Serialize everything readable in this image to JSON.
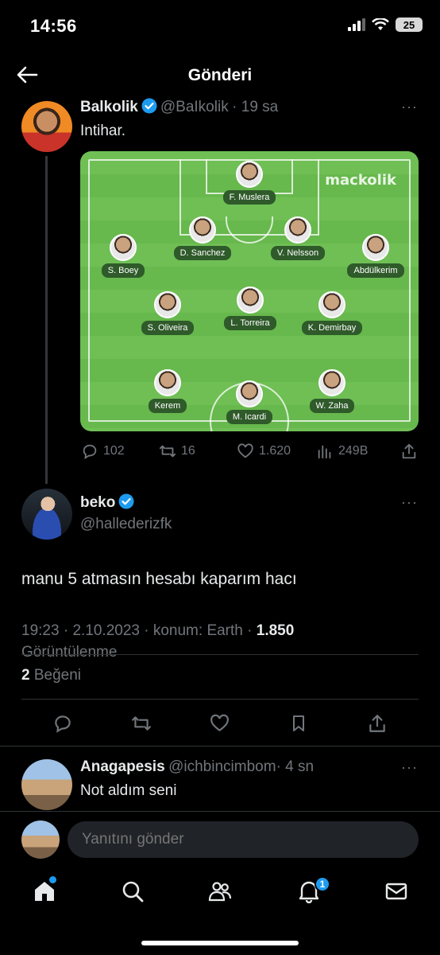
{
  "status_bar": {
    "time": "14:56",
    "battery": "25"
  },
  "header": {
    "title": "Gönderi"
  },
  "original_tweet": {
    "name": "Balkolik",
    "handle": "@BaIkolik",
    "time": "· 19 sa",
    "text": "Intihar.",
    "more": "···",
    "image": {
      "watermark": "mackolik",
      "players": [
        "F. Muslera",
        "D. Sanchez",
        "V. Nelsson",
        "S. Boey",
        "Abdülkerim",
        "S. Oliveira",
        "L. Torreira",
        "K. Demirbay",
        "Kerem",
        "M. Icardi",
        "W. Zaha"
      ]
    },
    "actions": {
      "replies": "102",
      "retweets": "16",
      "likes": "1.620",
      "views": "249B"
    }
  },
  "main_tweet": {
    "name": "beko",
    "handle": "@hallederizfk",
    "more": "···",
    "text": "manu 5 atmasın hesabı kaparım hacı",
    "time": "19:23",
    "date": "2.10.2023",
    "location": "konum: Earth",
    "views_count": "1.850",
    "views_label": "Görüntülenme",
    "likes_count": "2",
    "likes_label": "Beğeni"
  },
  "reply_tweet": {
    "name": "Anagapesis",
    "handle": "@ichbincimbom",
    "time": "· 4 sn",
    "more": "···",
    "text": "Not aldım seni"
  },
  "reply_box": {
    "placeholder": "Yanıtını gönder"
  },
  "bottom_nav": {
    "notifications_badge": "1"
  },
  "colors": {
    "accent": "#1d9bf0",
    "background": "#000000",
    "muted": "#71767b"
  },
  "icons": [
    "back-arrow-icon",
    "verified-icon",
    "reply-icon",
    "retweet-icon",
    "like-icon",
    "views-icon",
    "share-icon",
    "bookmark-icon",
    "home-icon",
    "search-icon",
    "communities-icon",
    "notifications-icon",
    "messages-icon"
  ]
}
